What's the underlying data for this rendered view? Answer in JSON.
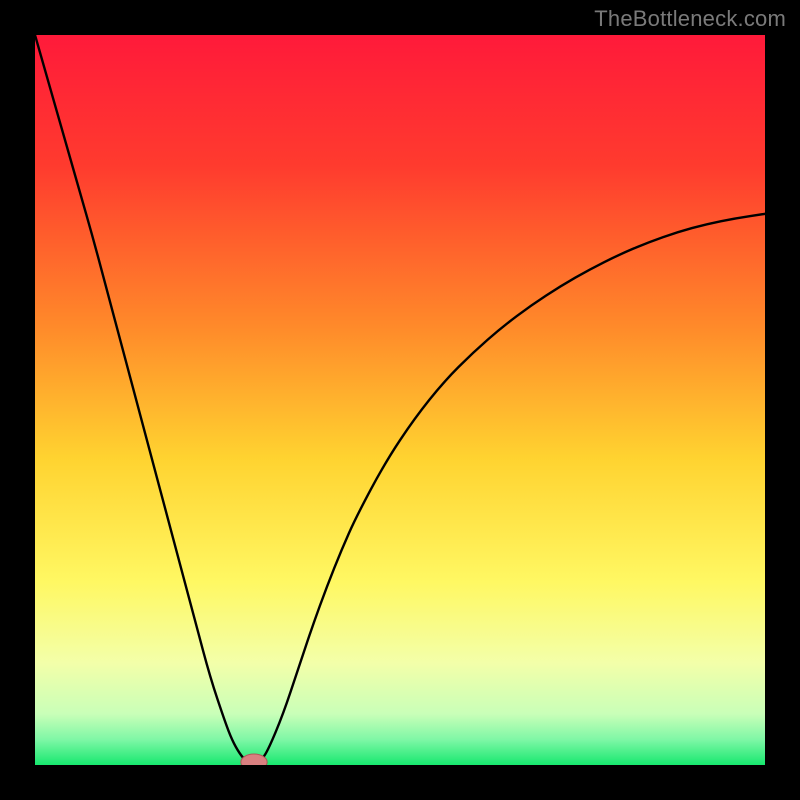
{
  "watermark": "TheBottleneck.com",
  "chart_data": {
    "type": "line",
    "title": "",
    "xlabel": "",
    "ylabel": "",
    "xlim": [
      0,
      100
    ],
    "ylim": [
      0,
      100
    ],
    "grid": false,
    "legend": false,
    "background_gradient_stops": [
      {
        "offset": 0.0,
        "color": "#ff1a3a"
      },
      {
        "offset": 0.18,
        "color": "#ff3b2e"
      },
      {
        "offset": 0.4,
        "color": "#ff8a2a"
      },
      {
        "offset": 0.58,
        "color": "#ffd330"
      },
      {
        "offset": 0.75,
        "color": "#fff863"
      },
      {
        "offset": 0.86,
        "color": "#f3ffa9"
      },
      {
        "offset": 0.93,
        "color": "#c9ffb8"
      },
      {
        "offset": 0.965,
        "color": "#7ff7a6"
      },
      {
        "offset": 1.0,
        "color": "#17e86f"
      }
    ],
    "series": [
      {
        "name": "bottleneck-curve",
        "color": "#000000",
        "x": [
          0,
          2,
          4,
          6,
          8,
          10,
          12,
          14,
          16,
          18,
          20,
          22,
          24,
          26,
          27,
          28,
          29,
          30,
          31,
          32,
          34,
          36,
          38,
          40,
          42,
          44,
          48,
          52,
          56,
          60,
          64,
          68,
          72,
          76,
          80,
          84,
          88,
          92,
          96,
          100
        ],
        "y": [
          100,
          93,
          86,
          79,
          72,
          64.5,
          57,
          49.5,
          42,
          34.5,
          27,
          19.5,
          12,
          6,
          3.4,
          1.6,
          0.4,
          0.0,
          0.6,
          2.2,
          7.0,
          13.0,
          19.0,
          24.5,
          29.5,
          34.0,
          41.5,
          47.5,
          52.5,
          56.5,
          60.0,
          63.0,
          65.6,
          67.9,
          69.9,
          71.6,
          73.0,
          74.1,
          74.9,
          75.5
        ]
      }
    ],
    "marker": {
      "name": "min-marker",
      "x": 30,
      "y": 0.4,
      "rx": 1.8,
      "ry": 1.1,
      "fill": "#d98080",
      "stroke": "#b05858"
    }
  }
}
